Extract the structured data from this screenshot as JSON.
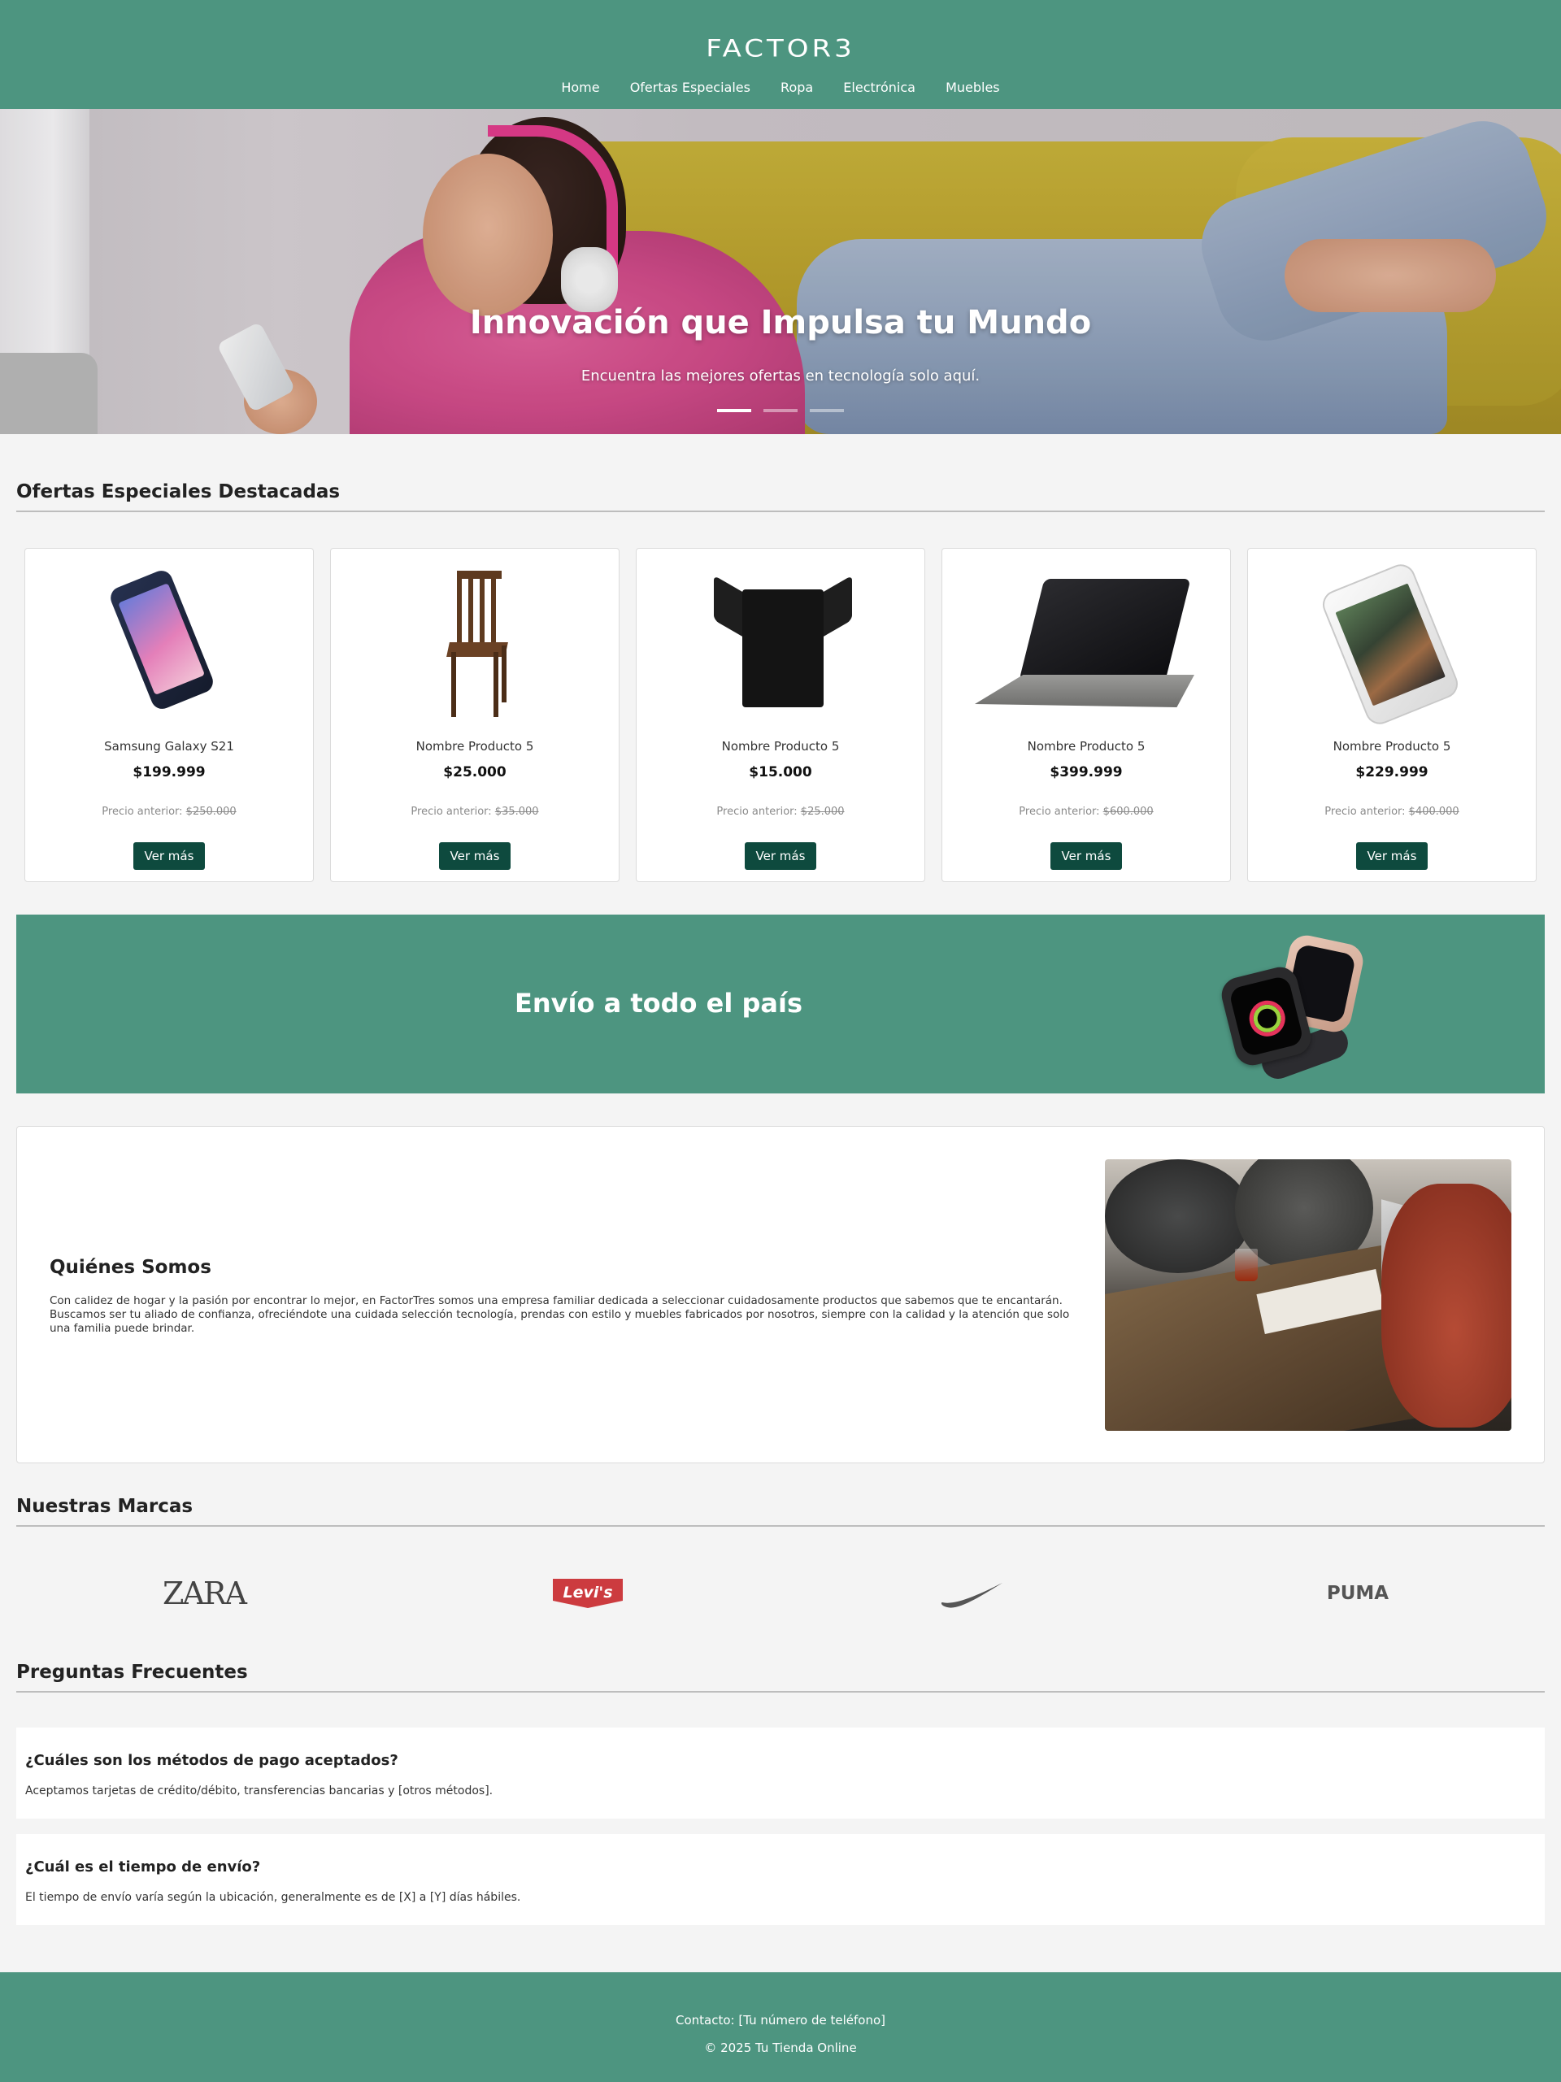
{
  "brand": {
    "logo_text": "FACTOR3"
  },
  "nav": {
    "items": [
      "Home",
      "Ofertas Especiales",
      "Ropa",
      "Electrónica",
      "Muebles"
    ]
  },
  "hero": {
    "title": "Innovación que Impulsa tu Mundo",
    "subtitle": "Encuentra las mejores ofertas en tecnología solo aquí.",
    "slide_count": 3,
    "active_slide": 1
  },
  "offers": {
    "title": "Ofertas Especiales Destacadas",
    "products": [
      {
        "name": "Samsung Galaxy S21",
        "price": "$199.999",
        "old_label": "Precio anterior:",
        "old_price": "$250.000",
        "button": "Ver más",
        "image_icon": "smartphone-icon"
      },
      {
        "name": "Nombre Producto 5",
        "price": "$25.000",
        "old_label": "Precio anterior:",
        "old_price": "$35.000",
        "button": "Ver más",
        "image_icon": "chair-icon"
      },
      {
        "name": "Nombre Producto 5",
        "price": "$15.000",
        "old_label": "Precio anterior:",
        "old_price": "$25.000",
        "button": "Ver más",
        "image_icon": "tshirt-icon"
      },
      {
        "name": "Nombre Producto 5",
        "price": "$399.999",
        "old_label": "Precio anterior:",
        "old_price": "$600.000",
        "button": "Ver más",
        "image_icon": "laptop-icon"
      },
      {
        "name": "Nombre Producto 5",
        "price": "$229.999",
        "old_label": "Precio anterior:",
        "old_price": "$400.000",
        "button": "Ver más",
        "image_icon": "iphone-icon"
      }
    ]
  },
  "shipping": {
    "title": "Envío a todo el país"
  },
  "about": {
    "title": "Quiénes Somos",
    "text": "Con calidez de hogar y la pasión por encontrar lo mejor, en FactorTres somos una empresa familiar dedicada a seleccionar cuidadosamente productos que sabemos que te encantarán. Buscamos ser tu aliado de confianza, ofreciéndote una cuidada selección tecnología, prendas con estilo y muebles fabricados por nosotros, siempre con la calidad y la atención que solo una familia puede brindar."
  },
  "brands": {
    "title": "Nuestras Marcas",
    "items": [
      {
        "name": "ZARA"
      },
      {
        "name": "Levi's"
      },
      {
        "name": "NIKE"
      },
      {
        "name": "PUMA"
      }
    ]
  },
  "faq": {
    "title": "Preguntas Frecuentes",
    "items": [
      {
        "q": "¿Cuáles son los métodos de pago aceptados?",
        "a": "Aceptamos tarjetas de crédito/débito, transferencias bancarias y [otros métodos]."
      },
      {
        "q": "¿Cuál es el tiempo de envío?",
        "a": "El tiempo de envío varía según la ubicación, generalmente es de [X] a [Y] días hábiles."
      }
    ]
  },
  "footer": {
    "contact": "Contacto: [Tu número de teléfono]",
    "copyright": "© 2025 Tu Tienda Online"
  },
  "colors": {
    "primary": "#4d9580",
    "button": "#0e4a3e",
    "background": "#f4f4f4"
  }
}
